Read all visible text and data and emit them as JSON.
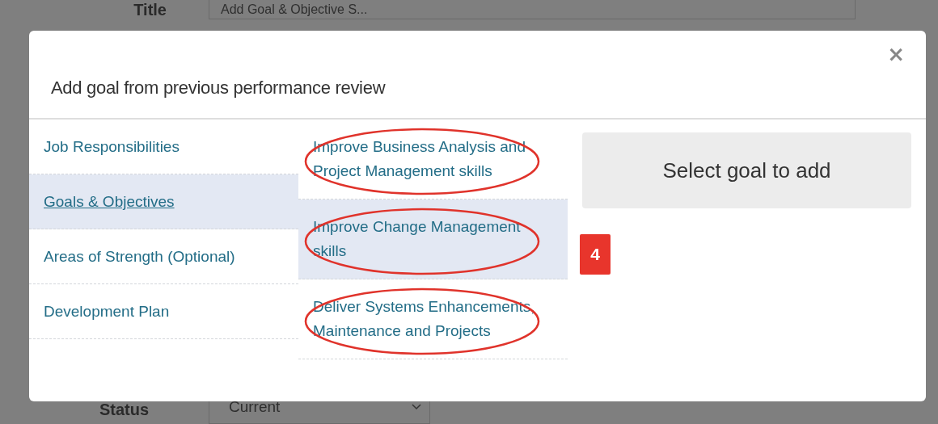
{
  "page": {
    "title_label": "Title",
    "title_value": "Add Goal & Objective S...",
    "status_label": "Status",
    "status_value": "Current"
  },
  "dialog": {
    "title": "Add goal from previous performance review",
    "close": "×",
    "sections": [
      {
        "label": "Job Responsibilities",
        "selected": false
      },
      {
        "label": "Goals & Objectives",
        "selected": true
      },
      {
        "label": "Areas of Strength (Optional)",
        "selected": false
      },
      {
        "label": "Development Plan",
        "selected": false
      }
    ],
    "goals": [
      {
        "label": "Improve Business Analysis and Project Management skills",
        "selected": false,
        "circled": true
      },
      {
        "label": "Improve Change Management skills",
        "selected": true,
        "circled": true
      },
      {
        "label": "Deliver Systems Enhancements, Maintenance and Projects",
        "selected": false,
        "circled": true
      }
    ],
    "placeholder_panel": "Select goal to add",
    "step_badge": "4"
  }
}
